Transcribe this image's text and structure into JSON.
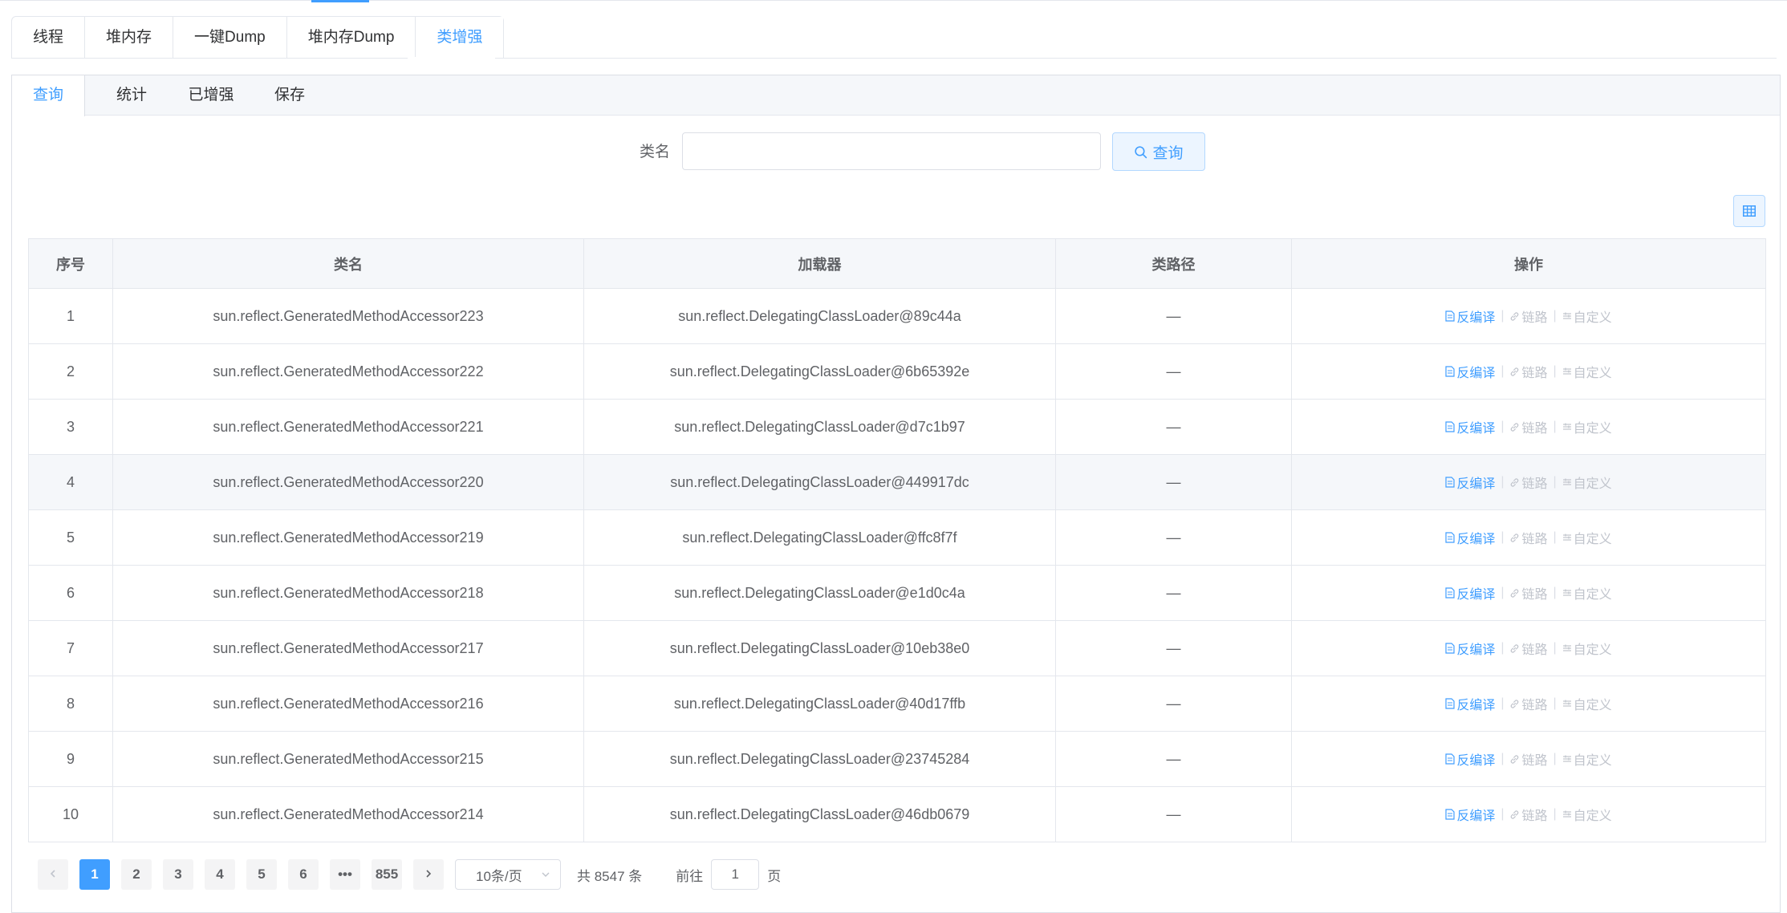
{
  "outer_tabs": [
    "线程",
    "堆内存",
    "一键Dump",
    "堆内存Dump",
    "类增强"
  ],
  "outer_active_tab": "类增强",
  "inner_tabs": [
    "查询",
    "统计",
    "已增强",
    "保存"
  ],
  "inner_active_tab": "查询",
  "search": {
    "label": "类名",
    "value": "",
    "placeholder": "",
    "button_label": "查询"
  },
  "table": {
    "headers": [
      "序号",
      "类名",
      "加载器",
      "类路径",
      "操作"
    ],
    "actions": {
      "decompile": "反编译",
      "link": "链路",
      "custom": "自定义"
    },
    "rows": [
      {
        "index": "1",
        "class_name": "sun.reflect.GeneratedMethodAccessor223",
        "loader": "sun.reflect.DelegatingClassLoader@89c44a",
        "path": "—"
      },
      {
        "index": "2",
        "class_name": "sun.reflect.GeneratedMethodAccessor222",
        "loader": "sun.reflect.DelegatingClassLoader@6b65392e",
        "path": "—"
      },
      {
        "index": "3",
        "class_name": "sun.reflect.GeneratedMethodAccessor221",
        "loader": "sun.reflect.DelegatingClassLoader@d7c1b97",
        "path": "—"
      },
      {
        "index": "4",
        "class_name": "sun.reflect.GeneratedMethodAccessor220",
        "loader": "sun.reflect.DelegatingClassLoader@449917dc",
        "path": "—"
      },
      {
        "index": "5",
        "class_name": "sun.reflect.GeneratedMethodAccessor219",
        "loader": "sun.reflect.DelegatingClassLoader@ffc8f7f",
        "path": "—"
      },
      {
        "index": "6",
        "class_name": "sun.reflect.GeneratedMethodAccessor218",
        "loader": "sun.reflect.DelegatingClassLoader@e1d0c4a",
        "path": "—"
      },
      {
        "index": "7",
        "class_name": "sun.reflect.GeneratedMethodAccessor217",
        "loader": "sun.reflect.DelegatingClassLoader@10eb38e0",
        "path": "—"
      },
      {
        "index": "8",
        "class_name": "sun.reflect.GeneratedMethodAccessor216",
        "loader": "sun.reflect.DelegatingClassLoader@40d17ffb",
        "path": "—"
      },
      {
        "index": "9",
        "class_name": "sun.reflect.GeneratedMethodAccessor215",
        "loader": "sun.reflect.DelegatingClassLoader@23745284",
        "path": "—"
      },
      {
        "index": "10",
        "class_name": "sun.reflect.GeneratedMethodAccessor214",
        "loader": "sun.reflect.DelegatingClassLoader@46db0679",
        "path": "—"
      }
    ]
  },
  "pagination": {
    "prev_icon": "chevron-left-icon",
    "next_icon": "chevron-right-icon",
    "pages": [
      "1",
      "2",
      "3",
      "4",
      "5",
      "6",
      "•••",
      "855"
    ],
    "current": "1",
    "page_size": "10条/页",
    "total": "共 8547 条",
    "goto_prefix": "前往",
    "goto_value": "1",
    "goto_suffix": "页"
  },
  "colors": {
    "primary": "#409eff",
    "border": "#e4e7ed",
    "header_bg": "#f5f7fa",
    "muted": "#c0c4cc"
  }
}
